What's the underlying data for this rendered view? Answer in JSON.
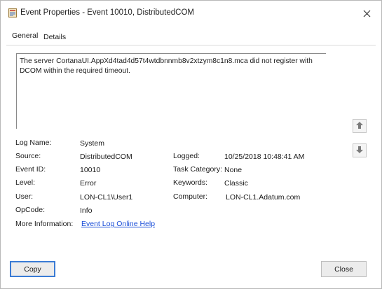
{
  "window": {
    "title": "Event Properties - Event 10010, DistributedCOM"
  },
  "tabs": [
    {
      "label": "General"
    },
    {
      "label": "Details"
    }
  ],
  "message": "The server CortanaUI.AppXd4tad4d57t4wtdbnnmb8v2xtzym8c1n8.mca did not register with DCOM within the required timeout.",
  "fields": {
    "log_name": {
      "label": "Log Name:",
      "value": "System"
    },
    "source": {
      "label": "Source:",
      "value": "DistributedCOM"
    },
    "event_id": {
      "label": "Event ID:",
      "value": "10010"
    },
    "level": {
      "label": "Level:",
      "value": "Error"
    },
    "user": {
      "label": "User:",
      "value": "LON-CL1\\User1"
    },
    "opcode": {
      "label": "OpCode:",
      "value": "Info"
    },
    "more_info": {
      "label": "More Information:",
      "value": "Event Log Online Help"
    },
    "logged": {
      "label": "Logged:",
      "value": "10/25/2018 10:48:41 AM"
    },
    "task_category": {
      "label": "Task Category:",
      "value": "None"
    },
    "keywords": {
      "label": "Keywords:",
      "value": "Classic"
    },
    "computer": {
      "label": "Computer:",
      "value": "LON-CL1.Adatum.com"
    }
  },
  "buttons": {
    "copy": "Copy",
    "close": "Close"
  },
  "icons": {
    "app": "event-viewer-icon",
    "close": "close-icon",
    "up": "arrow-up-icon",
    "down": "arrow-down-icon"
  },
  "colors": {
    "link": "#1a4ed8",
    "focus_border": "#3a7bd5"
  }
}
